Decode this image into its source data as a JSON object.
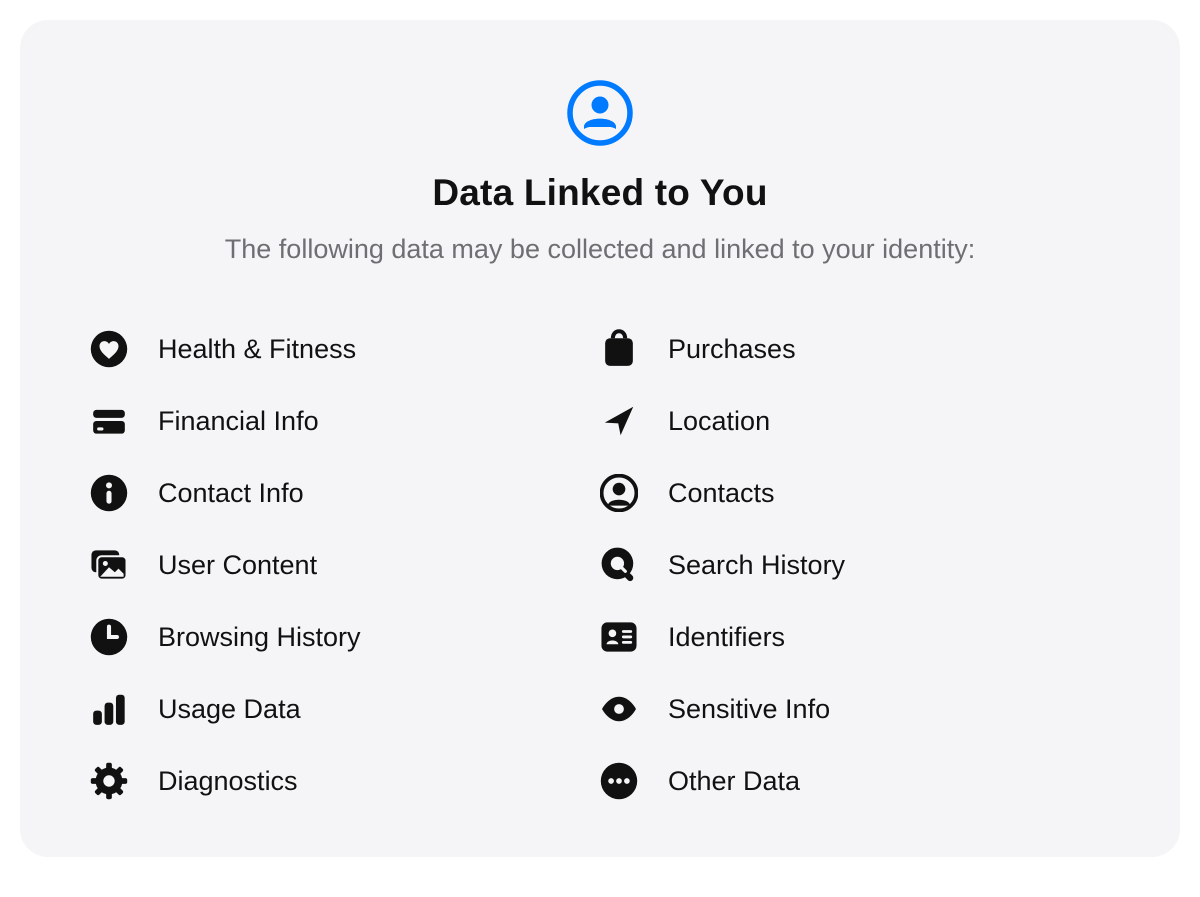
{
  "header": {
    "icon": "person-circle-icon",
    "title": "Data Linked to You",
    "subtitle": "The following data may be collected and linked to your identity:",
    "accent_color": "#007aff"
  },
  "columns": {
    "left": [
      {
        "icon": "heart-icon",
        "label": "Health & Fitness"
      },
      {
        "icon": "credit-card-icon",
        "label": "Financial Info"
      },
      {
        "icon": "info-icon",
        "label": "Contact Info"
      },
      {
        "icon": "photo-stack-icon",
        "label": "User Content"
      },
      {
        "icon": "clock-icon",
        "label": "Browsing History"
      },
      {
        "icon": "bar-chart-icon",
        "label": "Usage Data"
      },
      {
        "icon": "gear-icon",
        "label": "Diagnostics"
      }
    ],
    "right": [
      {
        "icon": "shopping-bag-icon",
        "label": "Purchases"
      },
      {
        "icon": "location-arrow-icon",
        "label": "Location"
      },
      {
        "icon": "contacts-icon",
        "label": "Contacts"
      },
      {
        "icon": "search-icon",
        "label": "Search History"
      },
      {
        "icon": "id-card-icon",
        "label": "Identifiers"
      },
      {
        "icon": "eye-icon",
        "label": "Sensitive Info"
      },
      {
        "icon": "ellipsis-icon",
        "label": "Other Data"
      }
    ]
  }
}
